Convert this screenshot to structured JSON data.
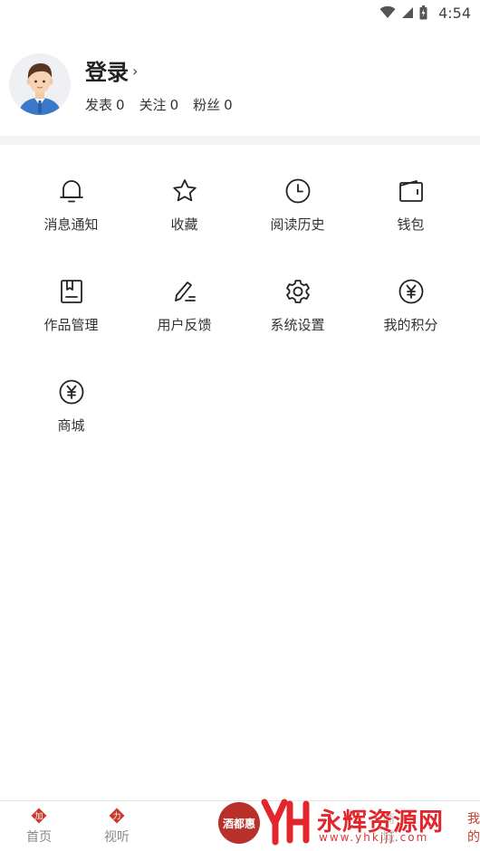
{
  "status_bar": {
    "time": "4:54",
    "icons": [
      "wifi-icon",
      "cellular-signal-icon",
      "battery-charging-icon"
    ]
  },
  "profile": {
    "login_label": "登录",
    "chevron": "›",
    "stats": [
      {
        "label": "发表",
        "value": "0"
      },
      {
        "label": "关注",
        "value": "0"
      },
      {
        "label": "粉丝",
        "value": "0"
      }
    ]
  },
  "menu": [
    {
      "label": "消息通知",
      "icon": "bell-icon"
    },
    {
      "label": "收藏",
      "icon": "star-icon"
    },
    {
      "label": "阅读历史",
      "icon": "clock-icon"
    },
    {
      "label": "钱包",
      "icon": "wallet-icon"
    },
    {
      "label": "作品管理",
      "icon": "book-icon"
    },
    {
      "label": "用户反馈",
      "icon": "pen-icon"
    },
    {
      "label": "系统设置",
      "icon": "gear-icon"
    },
    {
      "label": "我的积分",
      "icon": "yen-circle-icon"
    },
    {
      "label": "商城",
      "icon": "yen-circle-icon"
    }
  ],
  "tab_bar": {
    "tabs": [
      {
        "label": "首页",
        "badge": "加"
      },
      {
        "label": "视听",
        "badge": "力"
      },
      {
        "label": "商城",
        "badge": ""
      },
      {
        "label": "我的",
        "badge": ""
      }
    ],
    "center_logo_text": "酒都惠"
  },
  "watermark": {
    "text": "永辉资源网",
    "url": "www.yhkjjj.com"
  },
  "colors": {
    "accent": "#c83a2e",
    "text": "#333333",
    "divider": "#f4f4f4"
  }
}
